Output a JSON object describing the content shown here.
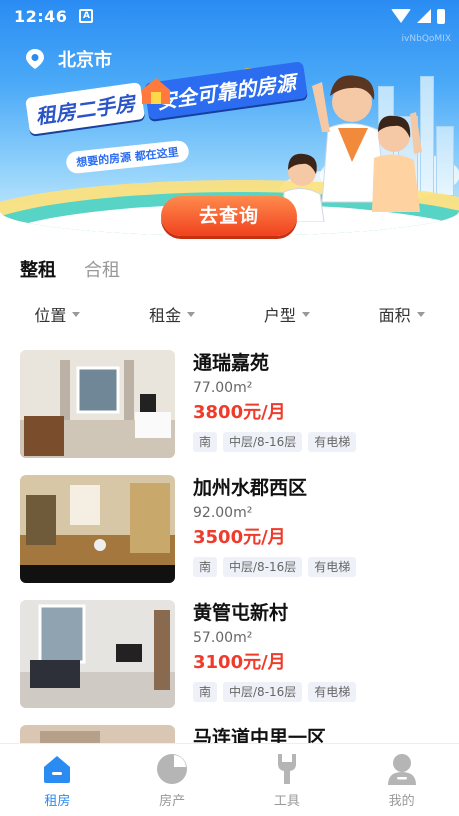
{
  "status_bar": {
    "time": "12:46",
    "notif_letter": "A"
  },
  "watermark": "ivNbQoMIX",
  "location": {
    "city": "北京市"
  },
  "banner": {
    "slogan_part1": "租房二手房",
    "slogan_part2": "安全可靠的房源",
    "subtitle": "想要的房源 都在这里",
    "button_label": "去查询"
  },
  "tabs": [
    {
      "label": "整租",
      "active": true
    },
    {
      "label": "合租",
      "active": false
    }
  ],
  "filters": [
    {
      "label": "位置"
    },
    {
      "label": "租金"
    },
    {
      "label": "户型"
    },
    {
      "label": "面积"
    }
  ],
  "listings": [
    {
      "title": "通瑞嘉苑",
      "area": "77.00m²",
      "price": "3800元/月",
      "tags": [
        "南",
        "中层/8-16层",
        "有电梯"
      ]
    },
    {
      "title": "加州水郡西区",
      "area": "92.00m²",
      "price": "3500元/月",
      "tags": [
        "南",
        "中层/8-16层",
        "有电梯"
      ]
    },
    {
      "title": "黄管屯新村",
      "area": "57.00m²",
      "price": "3100元/月",
      "tags": [
        "南",
        "中层/8-16层",
        "有电梯"
      ]
    },
    {
      "title": "马连道中里一区",
      "area": "",
      "price": "",
      "tags": []
    }
  ],
  "bottom_nav": [
    {
      "label": "租房",
      "icon": "home-icon",
      "active": true
    },
    {
      "label": "房产",
      "icon": "pie-chart-icon",
      "active": false
    },
    {
      "label": "工具",
      "icon": "wrench-icon",
      "active": false
    },
    {
      "label": "我的",
      "icon": "user-icon",
      "active": false
    }
  ],
  "colors": {
    "accent": "#2a8cf3",
    "price": "#ee3b2b",
    "button": "#f0421f",
    "tab_underline": "#38d39f"
  }
}
